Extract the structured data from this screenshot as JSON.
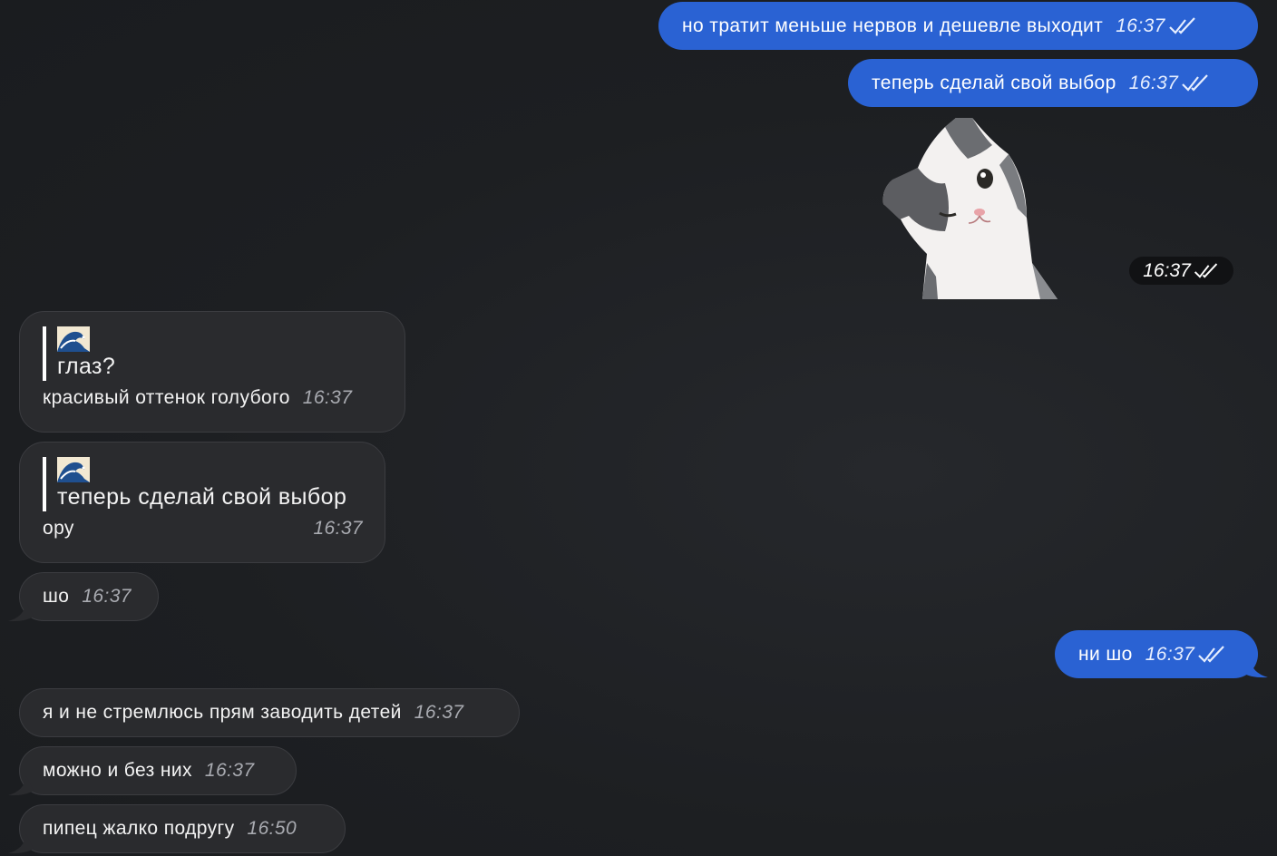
{
  "outgoing": [
    {
      "text": "но тратит меньше нервов и дешевле выходит",
      "time": "16:37"
    },
    {
      "text": "теперь сделай свой выбор",
      "time": "16:37"
    },
    {
      "text": "ни шо",
      "time": "16:37"
    }
  ],
  "sticker": {
    "icon": "cat-winking-sticker",
    "time": "16:37"
  },
  "incoming": [
    {
      "quote_icon": "wave-emoji",
      "quote": "глаз?",
      "text": "красивый оттенок голубого",
      "time": "16:37"
    },
    {
      "quote_icon": "wave-emoji",
      "quote": "теперь сделай свой выбор",
      "text": "ору",
      "time": "16:37"
    },
    {
      "text": "шо",
      "time": "16:37"
    },
    {
      "text": "я и не стремлюсь прям заводить детей",
      "time": "16:37"
    },
    {
      "text": "можно и без них",
      "time": "16:37"
    },
    {
      "text": "пипец жалко подругу",
      "time": "16:50"
    }
  ],
  "colors": {
    "outgoing_bubble": "#2a62d3",
    "incoming_bubble": "#2a2b2e",
    "background": "#1c1e21"
  }
}
